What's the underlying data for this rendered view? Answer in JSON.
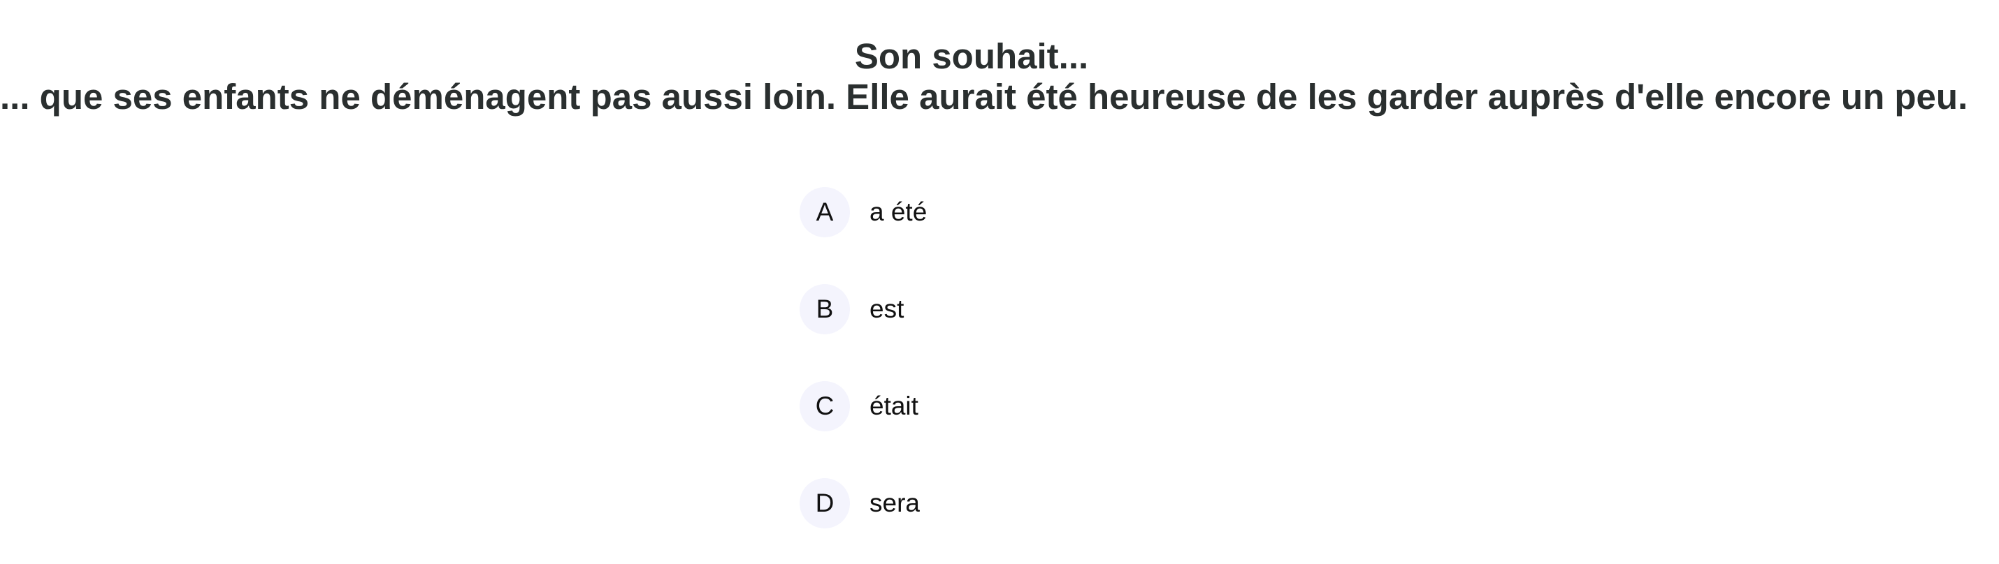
{
  "question": {
    "title": "Son souhait...",
    "sentence": "... que ses enfants ne déménagent pas aussi loin. Elle aurait été heureuse de les garder auprès d'elle encore un peu."
  },
  "options": [
    {
      "letter": "A",
      "text": "a été"
    },
    {
      "letter": "B",
      "text": "est"
    },
    {
      "letter": "C",
      "text": "était"
    },
    {
      "letter": "D",
      "text": "sera"
    }
  ]
}
